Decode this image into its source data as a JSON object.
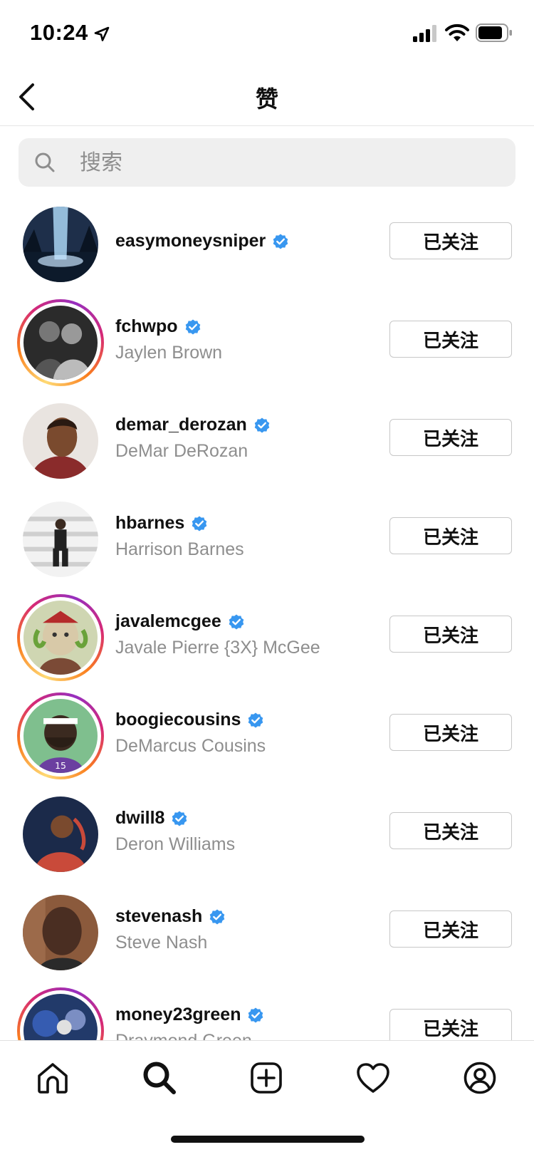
{
  "status_bar": {
    "time": "10:24"
  },
  "header": {
    "title": "赞"
  },
  "search": {
    "placeholder": "搜索"
  },
  "users": [
    {
      "username": "easymoneysniper",
      "full_name": "",
      "verified": true,
      "story_ring": false,
      "button": "已关注",
      "avatar": "blue-waterfall-night"
    },
    {
      "username": "fchwpo",
      "full_name": "Jaylen Brown",
      "verified": true,
      "story_ring": true,
      "button": "已关注",
      "avatar": "two-players-bw"
    },
    {
      "username": "demar_derozan",
      "full_name": "DeMar DeRozan",
      "verified": true,
      "story_ring": false,
      "button": "已关注",
      "avatar": "cartoon-portrait"
    },
    {
      "username": "hbarnes",
      "full_name": "Harrison Barnes",
      "verified": true,
      "story_ring": false,
      "button": "已关注",
      "avatar": "man-on-stairs"
    },
    {
      "username": "javalemcgee",
      "full_name": "Javale Pierre {3X} McGee",
      "verified": true,
      "story_ring": true,
      "button": "已关注",
      "avatar": "cartoon-ape-green"
    },
    {
      "username": "boogiecousins",
      "full_name": "DeMarcus Cousins",
      "verified": true,
      "story_ring": true,
      "button": "已关注",
      "avatar": "cartoon-ape-jersey-15"
    },
    {
      "username": "dwill8",
      "full_name": "Deron Williams",
      "verified": true,
      "story_ring": false,
      "button": "已关注",
      "avatar": "player-navy"
    },
    {
      "username": "stevenash",
      "full_name": "Steve Nash",
      "verified": true,
      "story_ring": false,
      "button": "已关注",
      "avatar": "man-portrait-brown"
    },
    {
      "username": "money23green",
      "full_name": "Draymond Green",
      "verified": true,
      "story_ring": true,
      "button": "已关注",
      "avatar": "player-arena-blue"
    }
  ],
  "tabbar": {
    "tabs": [
      "home-icon",
      "search-icon",
      "create-icon",
      "activity-heart-icon",
      "profile-icon"
    ],
    "active": "search-icon"
  },
  "colors": {
    "verified_blue": "#3897f0",
    "text_primary": "#262626",
    "text_secondary": "#8e8e8e",
    "border": "#c7c7c7"
  }
}
